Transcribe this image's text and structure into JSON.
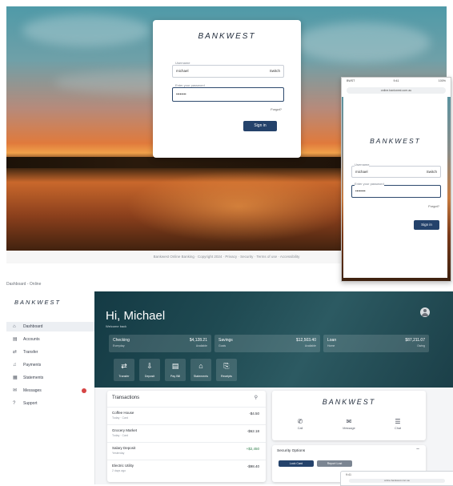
{
  "login_desktop": {
    "logo": "BANKWEST",
    "username_label": "Username",
    "username_value": "michael",
    "username_action": "Switch",
    "password_label": "Enter your password",
    "password_value": "••••••••",
    "forgot": "Forgot?",
    "signin": "Sign in"
  },
  "caption": "Bankwest Online Banking · Copyright 2024 · Privacy · Security · Terms of use · Accessibility",
  "phone": {
    "time": "9:41",
    "carrier": "BWST",
    "battery": "100%",
    "url": "online.bankwest.com.au",
    "logo": "BANKWEST",
    "username_label": "Username",
    "username_value": "michael",
    "username_action": "Switch",
    "password_label": "Enter your password",
    "password_value": "••••••••",
    "forgot": "Forgot?",
    "signin": "Sign in"
  },
  "tab_caption": "Dashboard - Online",
  "sidebar": {
    "logo": "BANKWEST",
    "items": [
      {
        "label": "Dashboard",
        "icon": "home-icon",
        "glyph": "⌂"
      },
      {
        "label": "Accounts",
        "icon": "wallet-icon",
        "glyph": "▤"
      },
      {
        "label": "Transfer",
        "icon": "transfer-icon",
        "glyph": "⇄"
      },
      {
        "label": "Payments",
        "icon": "bell-icon",
        "glyph": "♫"
      },
      {
        "label": "Statements",
        "icon": "document-icon",
        "glyph": "▦"
      },
      {
        "label": "Messages",
        "icon": "mail-icon",
        "glyph": "✉"
      },
      {
        "label": "Support",
        "icon": "help-icon",
        "glyph": "?"
      }
    ]
  },
  "dashboard": {
    "greeting": "Hi, Michael",
    "subtitle": "Welcome back",
    "accounts": [
      {
        "name": "Checking",
        "sub": "Everyday",
        "balance": "$4,128.21",
        "avail": "Available"
      },
      {
        "name": "Savings",
        "sub": "Goals",
        "balance": "$12,503.40",
        "avail": "Available"
      },
      {
        "name": "Loan",
        "sub": "Home",
        "balance": "$87,211.07",
        "avail": "Owing"
      }
    ],
    "quick_actions": [
      {
        "label": "Transfer",
        "glyph": "⇄",
        "icon": "transfer-icon"
      },
      {
        "label": "Deposit",
        "glyph": "⇩",
        "icon": "deposit-icon"
      },
      {
        "label": "Pay Bill",
        "glyph": "▤",
        "icon": "bill-icon"
      },
      {
        "label": "Statements",
        "glyph": "⌂",
        "icon": "statement-icon"
      },
      {
        "label": "Receipts",
        "glyph": "⎘",
        "icon": "receipt-icon"
      }
    ],
    "transactions_title": "Transactions",
    "transactions": [
      {
        "desc": "Coffee House",
        "meta": "Today · Card",
        "amount": "-$4.50",
        "pos": false
      },
      {
        "desc": "Grocery Market",
        "meta": "Today · Card",
        "amount": "-$62.18",
        "pos": false
      },
      {
        "desc": "Salary Deposit",
        "meta": "Yesterday",
        "amount": "+$2,450",
        "pos": true
      },
      {
        "desc": "Electric Utility",
        "meta": "2 days ago",
        "amount": "-$98.40",
        "pos": false
      }
    ],
    "card": {
      "logo": "BANKWEST",
      "actions": [
        {
          "label": "Call",
          "glyph": "✆",
          "icon": "phone-icon"
        },
        {
          "label": "Message",
          "glyph": "✉",
          "icon": "message-icon"
        },
        {
          "label": "Chat",
          "glyph": "☰",
          "icon": "chat-icon"
        }
      ]
    },
    "security_title": "Security Options",
    "security_buttons": [
      "Lock Card",
      "Report Lost"
    ]
  },
  "colors": {
    "brand": "#24426b",
    "banner": "#1f4a52",
    "alert": "#d64545"
  }
}
